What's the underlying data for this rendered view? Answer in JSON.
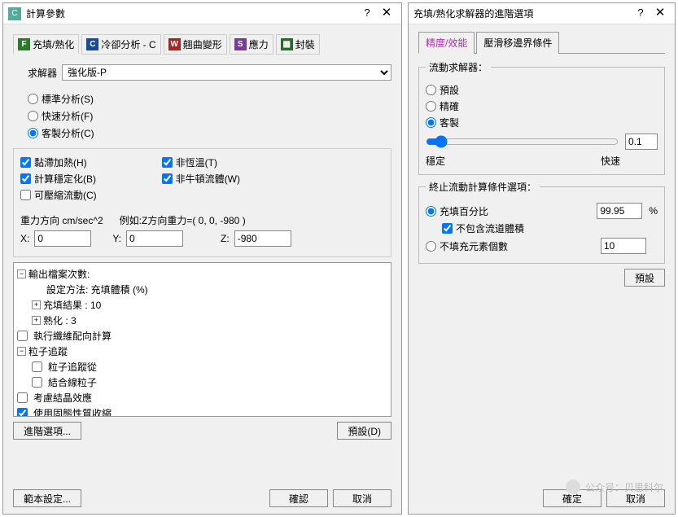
{
  "d1": {
    "title": "計算參數",
    "tabs": [
      "充填/熟化",
      "冷卻分析 - C",
      "翹曲變形",
      "應力",
      "封裝"
    ],
    "solver_lbl": "求解器",
    "solver_val": "強化版-P",
    "ana": {
      "std": "標準分析(S)",
      "fast": "快速分析(F)",
      "cust": "客製分析(C)"
    },
    "chk": {
      "h": "黏滯加熱(H)",
      "b": "計算穩定化(B)",
      "c": "可壓縮流動(C)",
      "t": "非恆溫(T)",
      "w": "非牛頓流體(W)"
    },
    "grav_lbl": "重力方向  cm/sec^2",
    "grav_ex": "例如:Z方向重力=( 0, 0, -980 )",
    "gx": "0",
    "gy": "0",
    "gz": "-980",
    "xl": "X:",
    "yl": "Y:",
    "zl": "Z:",
    "tree": {
      "n0": "輸出檔案次數:",
      "n1": "設定方法: 充填體積 (%)",
      "n2": "充填結果 : 10",
      "n3": "熟化 : 3",
      "n4": "執行纖維配向計算",
      "n5": "粒子追蹤",
      "n6": "粒子追蹤從",
      "n7": "結合線粒子",
      "n8": "考慮結晶效應",
      "n9": "使用固態性質收縮"
    },
    "adv": "進階選項...",
    "def": "預設(D)",
    "tpl": "範本設定...",
    "ok": "確認",
    "cancel": "取消"
  },
  "d2": {
    "title": "充填/熟化求解器的進階選項",
    "tabs": [
      "精度/效能",
      "壓滑移邊界條件"
    ],
    "fs1": "流動求解器：",
    "r": {
      "def": "預設",
      "acc": "精確",
      "cust": "客製"
    },
    "sval": "0.1",
    "s0": "穩定",
    "s1": "快速",
    "fs2": "終止流動計算條件選項：",
    "rp": "充填百分比",
    "pv": "99.95",
    "pu": "%",
    "ex": "不包含流道體積",
    "rn": "不填充元素個數",
    "nv": "10",
    "def": "預設",
    "ok": "確定",
    "cancel": "取消"
  },
  "wm": "公众号：贝思科尔"
}
